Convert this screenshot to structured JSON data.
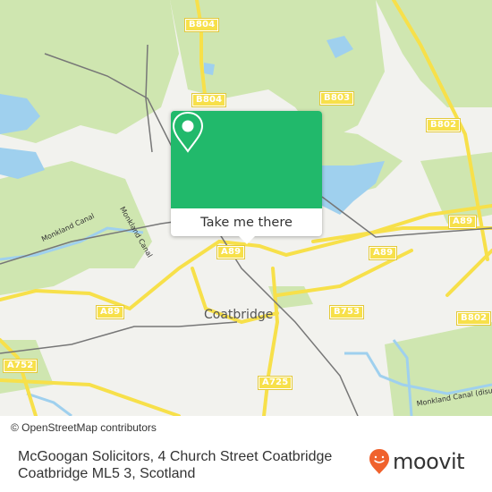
{
  "map": {
    "road_labels": [
      {
        "id": "b804-top",
        "text": "B804"
      },
      {
        "id": "b804-mid",
        "text": "B804"
      },
      {
        "id": "b803",
        "text": "B803"
      },
      {
        "id": "b802-top",
        "text": "B802"
      },
      {
        "id": "b802-right",
        "text": "B802"
      },
      {
        "id": "a89-center",
        "text": "A89"
      },
      {
        "id": "a89-right",
        "text": "A89"
      },
      {
        "id": "a89-east",
        "text": "A89"
      },
      {
        "id": "a89-left",
        "text": "A89"
      },
      {
        "id": "b753",
        "text": "B753"
      },
      {
        "id": "a725",
        "text": "A725"
      },
      {
        "id": "a752",
        "text": "A752"
      }
    ],
    "place_label": "Coatbridge",
    "canal_labels": [
      "Monkland Canal",
      "Monkland Canal",
      "Monkland Canal (disused)"
    ],
    "colors": {
      "land": "#f2f2ee",
      "park": "#cfe6b0",
      "water": "#9fd0ee",
      "road": "#f7e04a",
      "rail": "#777777"
    }
  },
  "popup": {
    "pin_icon": "map-pin-icon",
    "action_label": "Take me there",
    "color": "#21b96b"
  },
  "attribution": "© OpenStreetMap contributors",
  "footer": {
    "address": "McGoogan Solicitors, 4 Church Street Coatbridge Coatbridge ML5 3, Scotland",
    "brand": "moovit",
    "brand_color": "#f0622d"
  }
}
